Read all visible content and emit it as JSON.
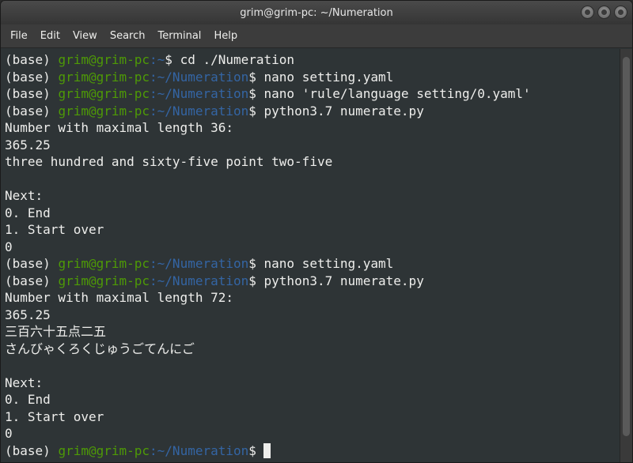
{
  "window": {
    "title": "grim@grim-pc: ~/Numeration",
    "buttons": [
      "minimize",
      "maximize",
      "close"
    ]
  },
  "menu": [
    "File",
    "Edit",
    "View",
    "Search",
    "Terminal",
    "Help"
  ],
  "colors": {
    "background": "#2e3436",
    "foreground": "#eeeeec",
    "user": "#4e9a06",
    "path": "#3465a4"
  },
  "lines": [
    {
      "type": "prompt",
      "env": "(base) ",
      "user": "grim@grim-pc",
      "path": ":~",
      "cmd": "$ cd ./Numeration"
    },
    {
      "type": "prompt",
      "env": "(base) ",
      "user": "grim@grim-pc",
      "path": ":~/Numeration",
      "cmd": "$ nano setting.yaml"
    },
    {
      "type": "prompt",
      "env": "(base) ",
      "user": "grim@grim-pc",
      "path": ":~/Numeration",
      "cmd": "$ nano 'rule/language setting/0.yaml'"
    },
    {
      "type": "prompt",
      "env": "(base) ",
      "user": "grim@grim-pc",
      "path": ":~/Numeration",
      "cmd": "$ python3.7 numerate.py"
    },
    {
      "type": "text",
      "text": "Number with maximal length 36:"
    },
    {
      "type": "text",
      "text": "365.25"
    },
    {
      "type": "text",
      "text": "three hundred and sixty-five point two-five"
    },
    {
      "type": "text",
      "text": ""
    },
    {
      "type": "text",
      "text": "Next:"
    },
    {
      "type": "text",
      "text": "0. End"
    },
    {
      "type": "text",
      "text": "1. Start over"
    },
    {
      "type": "text",
      "text": "0"
    },
    {
      "type": "prompt",
      "env": "(base) ",
      "user": "grim@grim-pc",
      "path": ":~/Numeration",
      "cmd": "$ nano setting.yaml"
    },
    {
      "type": "prompt",
      "env": "(base) ",
      "user": "grim@grim-pc",
      "path": ":~/Numeration",
      "cmd": "$ python3.7 numerate.py"
    },
    {
      "type": "text",
      "text": "Number with maximal length 72:"
    },
    {
      "type": "text",
      "text": "365.25"
    },
    {
      "type": "text",
      "text": "三百六十五点二五"
    },
    {
      "type": "text",
      "text": "さんびゃくろくじゅうごてんにご"
    },
    {
      "type": "text",
      "text": ""
    },
    {
      "type": "text",
      "text": "Next:"
    },
    {
      "type": "text",
      "text": "0. End"
    },
    {
      "type": "text",
      "text": "1. Start over"
    },
    {
      "type": "text",
      "text": "0"
    },
    {
      "type": "prompt",
      "env": "(base) ",
      "user": "grim@grim-pc",
      "path": ":~/Numeration",
      "cmd": "$",
      "cursor": true
    }
  ]
}
